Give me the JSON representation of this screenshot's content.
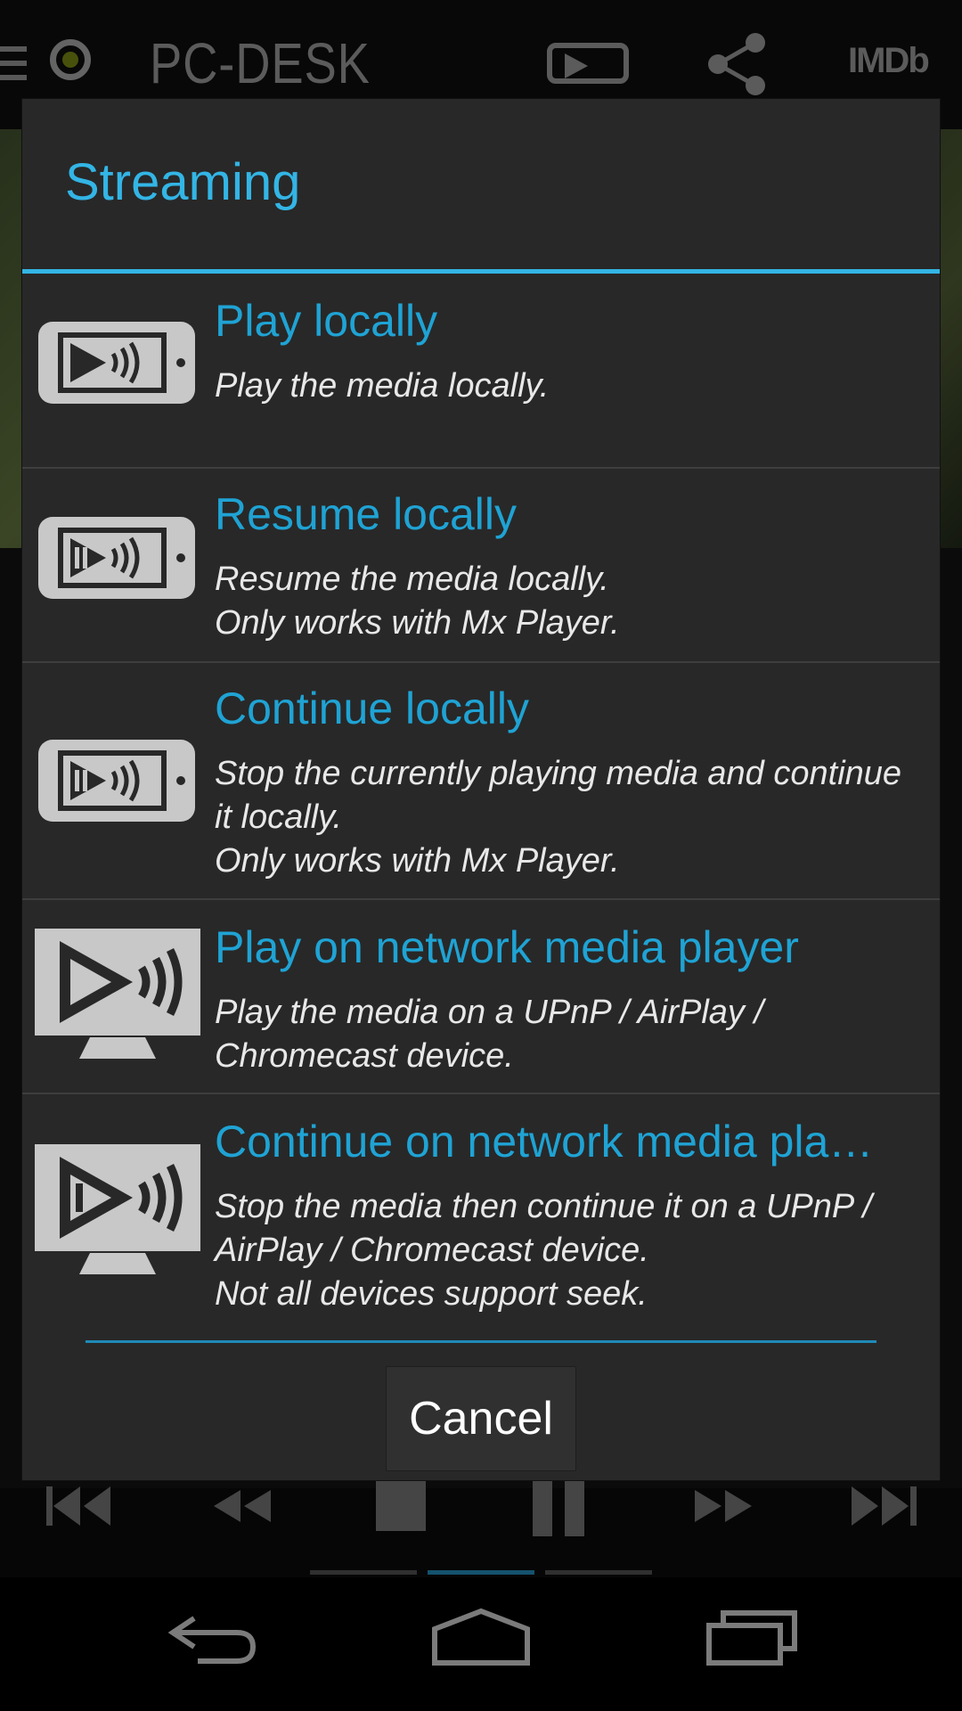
{
  "app": {
    "title": "PC-DESK",
    "imdb_label": "IMDb",
    "icons": [
      "menu-icon",
      "status-dot-icon",
      "streaming-icon",
      "share-icon",
      "imdb-icon"
    ]
  },
  "dialog": {
    "title": "Streaming",
    "options": [
      {
        "label": "Play locally",
        "description": "Play the media locally.",
        "icon": "phone-play-icon"
      },
      {
        "label": "Resume locally",
        "description": "Resume the media locally.\nOnly works with Mx Player.",
        "icon": "phone-resume-icon"
      },
      {
        "label": "Continue locally",
        "description": "Stop the currently playing media and continue\nit locally.\nOnly works with Mx Player.",
        "icon": "phone-continue-icon"
      },
      {
        "label": "Play on network media player",
        "description": "Play the media on a UPnP / AirPlay /\nChromecast device.",
        "icon": "tv-play-icon"
      },
      {
        "label": "Continue on network media pla…",
        "description": "Stop the media then continue it on a UPnP /\nAirPlay / Chromecast device.\nNot all devices support seek.",
        "icon": "tv-continue-icon"
      }
    ],
    "cancel_label": "Cancel"
  },
  "player_controls": [
    "skip-previous-icon",
    "rewind-icon",
    "stop-icon",
    "pause-icon",
    "fast-forward-icon",
    "skip-next-icon"
  ],
  "nav_bar": [
    "back-icon",
    "home-icon",
    "recents-icon"
  ],
  "colors": {
    "accent": "#33b5e5",
    "dialog_bg": "#282828",
    "option_text": "#1fa3d4"
  }
}
